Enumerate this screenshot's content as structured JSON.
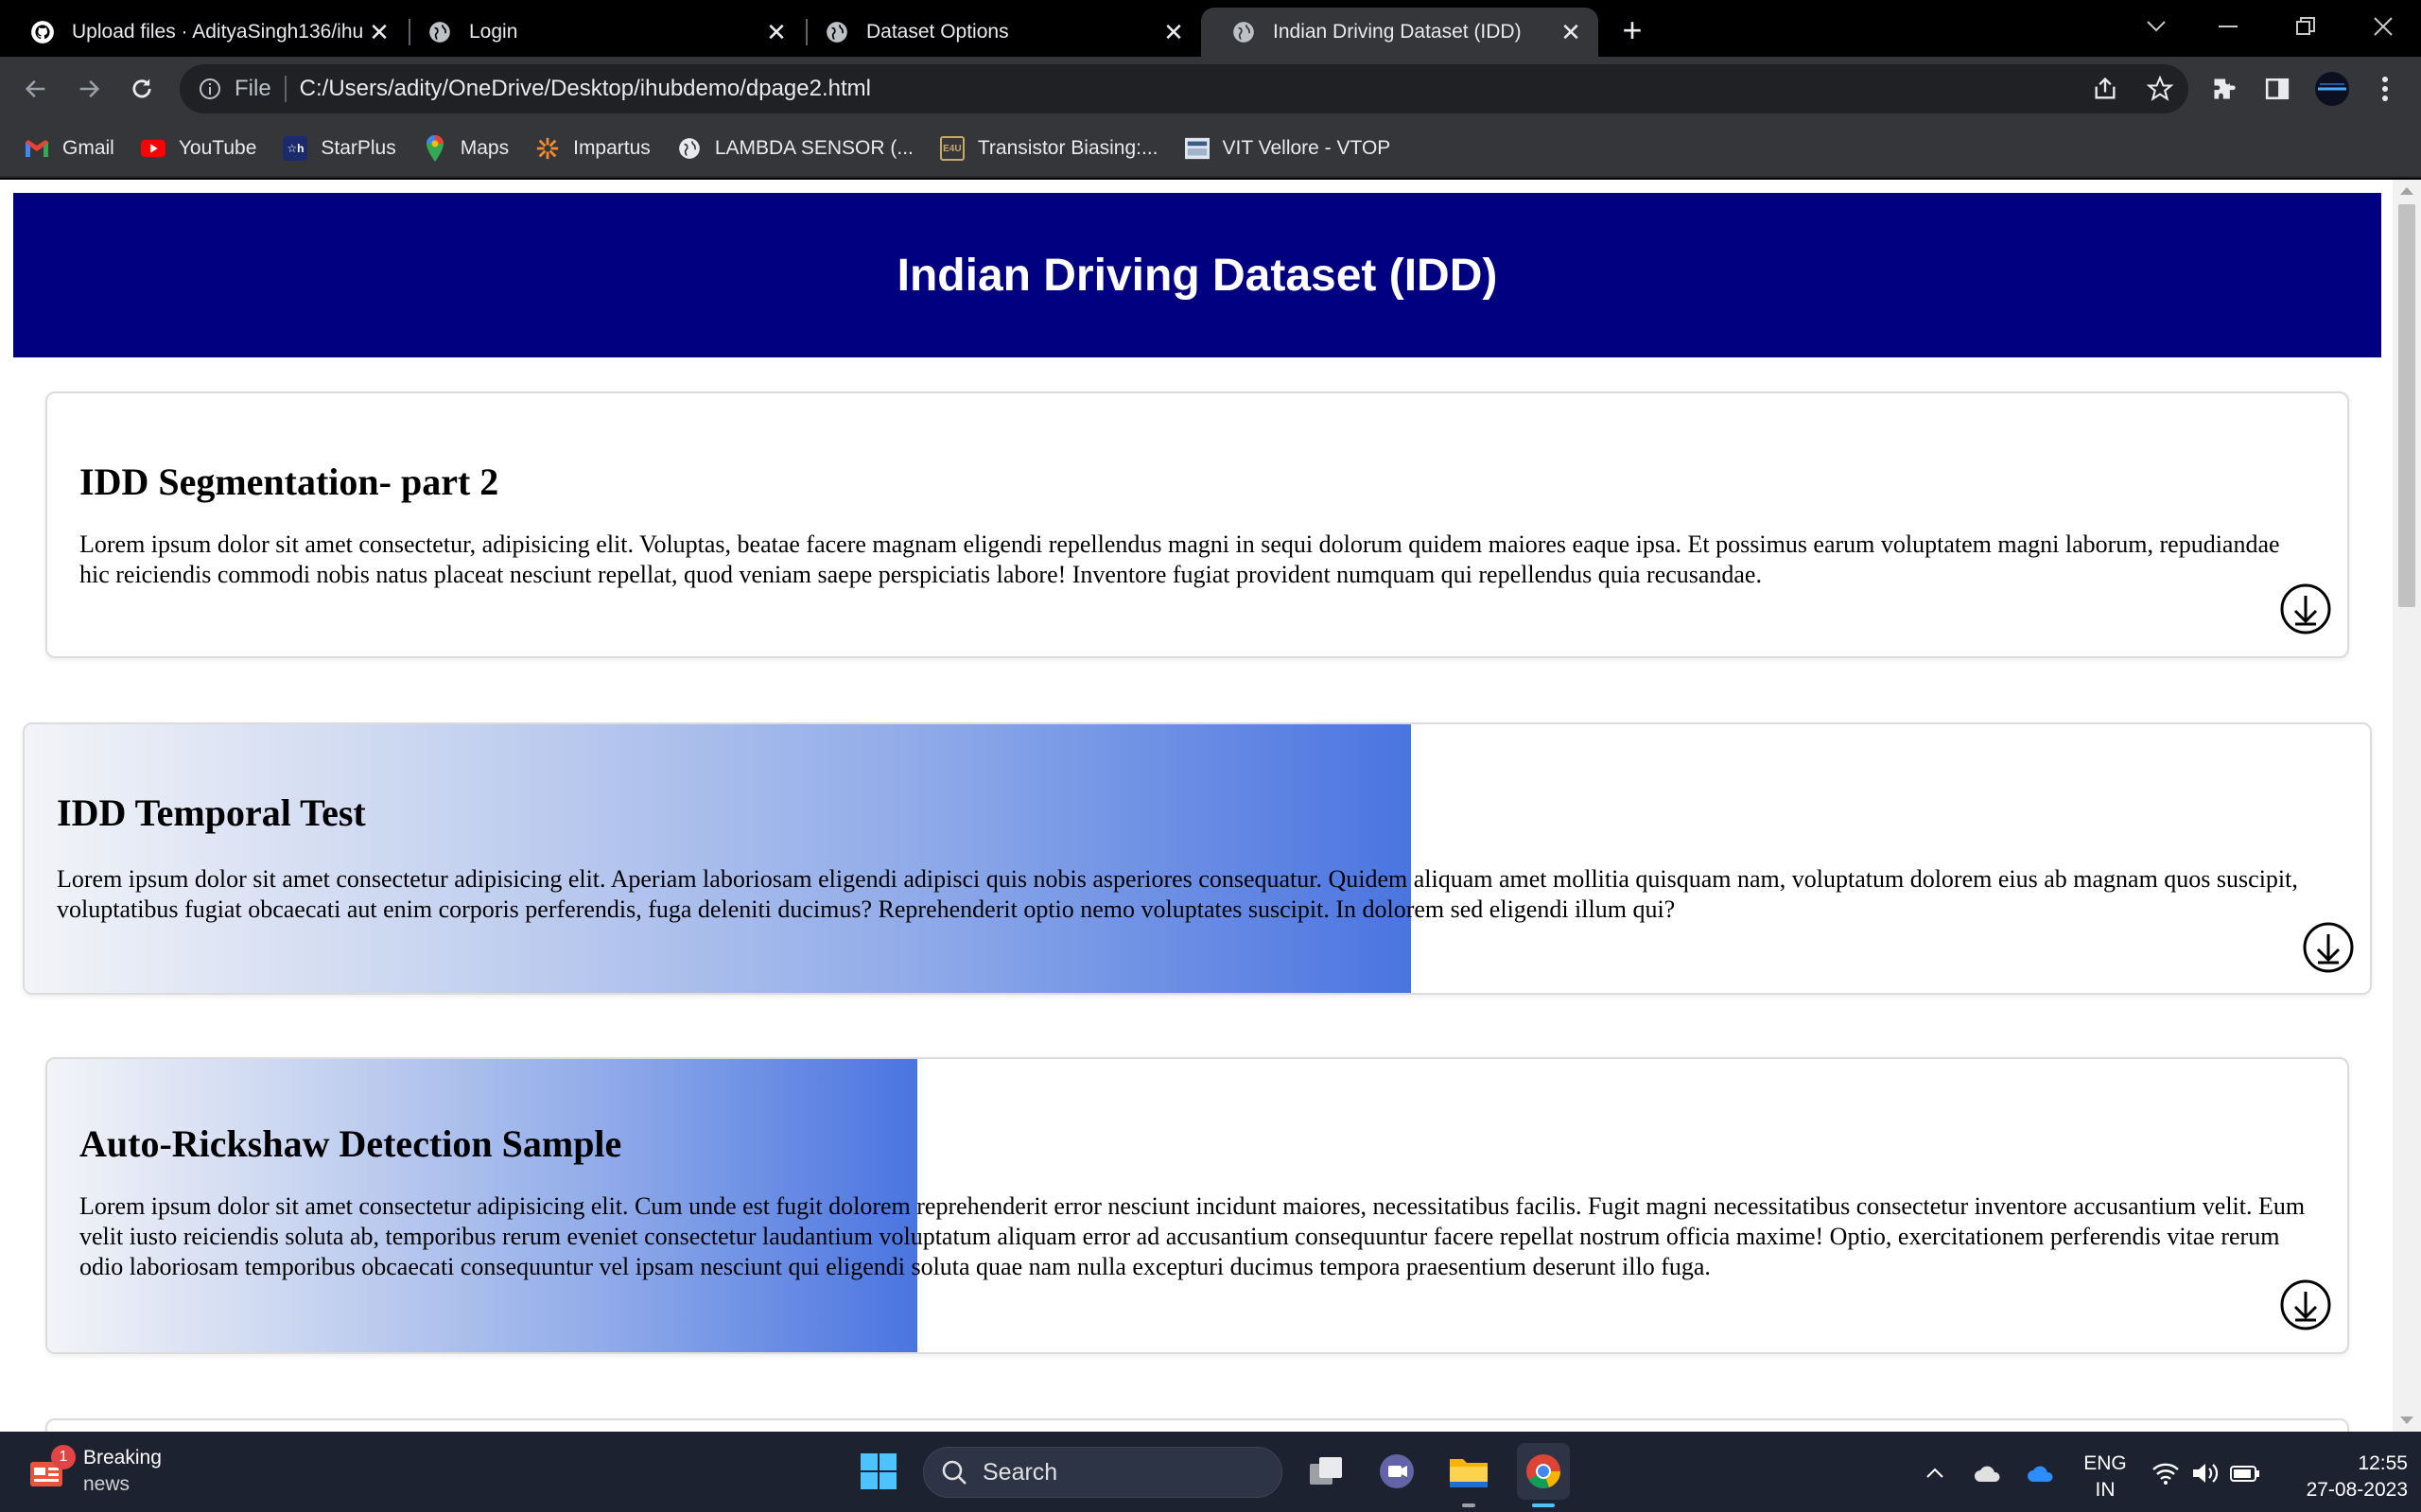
{
  "browser": {
    "tabs": [
      {
        "title": "Upload files · AdityaSingh136/ihu",
        "icon": "github-icon",
        "active": false
      },
      {
        "title": "Login",
        "icon": "globe-icon",
        "active": false
      },
      {
        "title": "Dataset Options",
        "icon": "globe-icon",
        "active": false
      },
      {
        "title": "Indian Driving Dataset (IDD)",
        "icon": "globe-icon",
        "active": true
      }
    ],
    "new_tab_label": "+",
    "address": {
      "scheme_label": "File",
      "url": "C:/Users/adity/OneDrive/Desktop/ihubdemo/dpage2.html"
    },
    "bookmarks": [
      {
        "label": "Gmail",
        "icon": "gmail-icon"
      },
      {
        "label": "YouTube",
        "icon": "youtube-icon"
      },
      {
        "label": "StarPlus",
        "icon": "starplus-icon"
      },
      {
        "label": "Maps",
        "icon": "maps-icon"
      },
      {
        "label": "Impartus",
        "icon": "impartus-icon"
      },
      {
        "label": "LAMBDA SENSOR (...",
        "icon": "globe-icon"
      },
      {
        "label": "Transistor Biasing:...",
        "icon": "e4u-icon"
      },
      {
        "label": "VIT Vellore - VTOP",
        "icon": "vtop-icon"
      }
    ]
  },
  "page": {
    "header_title": "Indian Driving Dataset (IDD)",
    "cards": [
      {
        "title": "IDD Segmentation- part 2",
        "text": "Lorem ipsum dolor sit amet consectetur, adipisicing elit. Voluptas, beatae facere magnam eligendi repellendus magni in sequi dolorum quidem maiores eaque ipsa. Et possimus earum voluptatem magni laborum, repudiandae hic reiciendis commodi nobis natus placeat nesciunt repellat, quod veniam saepe perspiciatis labore! Inventore fugiat provident numquam qui repellendus quia recusandae.",
        "download_icon": "download-icon"
      },
      {
        "title": "IDD Temporal Test",
        "text": "Lorem ipsum dolor sit amet consectetur adipisicing elit. Aperiam laboriosam eligendi adipisci quis nobis asperiores consequatur. Quidem aliquam amet mollitia quisquam nam, voluptatum dolorem eius ab magnam quos suscipit, voluptatibus fugiat obcaecati aut enim corporis perferendis, fuga deleniti ducimus? Reprehenderit optio nemo voluptates suscipit. In dolorem sed eligendi illum qui?",
        "download_icon": "download-icon"
      },
      {
        "title": "Auto-Rickshaw Detection Sample",
        "text": "Lorem ipsum dolor sit amet consectetur adipisicing elit. Cum unde est fugit dolorem reprehenderit error nesciunt incidunt maiores, necessitatibus facilis. Fugit magni necessitatibus consectetur inventore accusantium velit. Eum velit iusto reiciendis soluta ab, temporibus rerum eveniet consectetur laudantium voluptatum aliquam error ad accusantium consequuntur facere repellat nostrum officia maxime! Optio, exercitationem perferendis vitae rerum odio laboriosam temporibus obcaecati consequuntur vel ipsam nesciunt qui eligendi soluta quae nam nulla excepturi ducimus tempora praesentium deserunt illo fuga.",
        "download_icon": "download-icon"
      }
    ]
  },
  "taskbar": {
    "news_title": "Breaking",
    "news_sub": "news",
    "news_badge": "1",
    "search_placeholder": "Search",
    "lang_top": "ENG",
    "lang_bottom": "IN",
    "time": "12:55",
    "date": "27-08-2023"
  },
  "colors": {
    "header_bg": "#000080",
    "gradient_end": "#4a74e0",
    "active_tab_bg": "#35363a"
  }
}
